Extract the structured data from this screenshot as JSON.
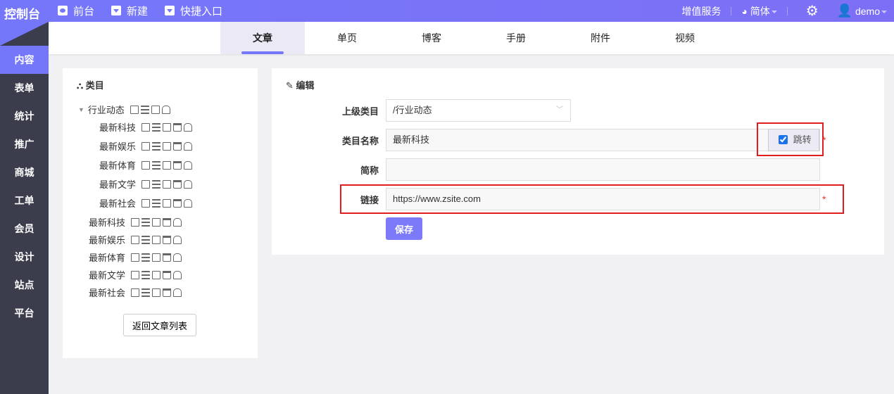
{
  "topbar": {
    "brand": "控制台",
    "nav": [
      "前台",
      "新建",
      "快捷入口"
    ],
    "vas": "增值服务",
    "lang": "简体",
    "user": "demo"
  },
  "sidebar": [
    "内容",
    "表单",
    "统计",
    "推广",
    "商城",
    "工单",
    "会员",
    "设计",
    "站点",
    "平台"
  ],
  "tabs": [
    "文章",
    "单页",
    "博客",
    "手册",
    "附件",
    "视频"
  ],
  "tree": {
    "title": "类目",
    "root": "行业动态",
    "children": [
      "最新科技",
      "最新娱乐",
      "最新体育",
      "最新文学",
      "最新社会"
    ],
    "top": [
      "最新科技",
      "最新娱乐",
      "最新体育",
      "最新文学",
      "最新社会"
    ],
    "back": "返回文章列表"
  },
  "form": {
    "title": "编辑",
    "parent_label": "上级类目",
    "parent_value": "/行业动态",
    "name_label": "类目名称",
    "name_value": "最新科技",
    "jump_label": "跳转",
    "jump_checked": true,
    "abbr_label": "简称",
    "abbr_value": "",
    "link_label": "链接",
    "link_value": "https://www.zsite.com",
    "required": "*",
    "save": "保存"
  }
}
